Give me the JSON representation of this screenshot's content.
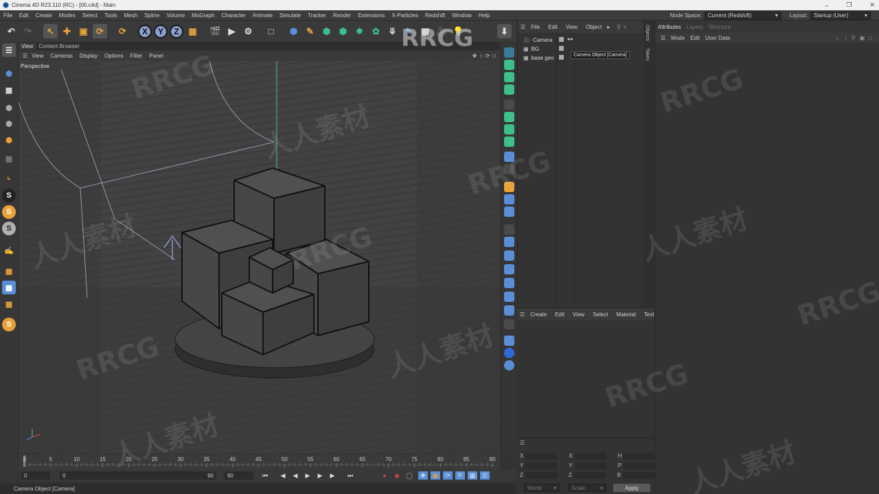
{
  "window": {
    "title": "Cinema 4D R23.110 (RC) - [00.c4d] - Main"
  },
  "menubar": {
    "items": [
      "File",
      "Edit",
      "Create",
      "Modes",
      "Select",
      "Tools",
      "Mesh",
      "Spline",
      "Volume",
      "MoGraph",
      "Character",
      "Animate",
      "Simulate",
      "Tracker",
      "Render",
      "Extensions",
      "X-Particles",
      "Redshift",
      "Window",
      "Help"
    ],
    "node_space_label": "Node Space:",
    "node_space_value": "Current (Redshift)",
    "layout_label": "Layout:",
    "layout_value": "Startup (User)"
  },
  "toolbar": {
    "axis_x": "X",
    "axis_y": "Y",
    "axis_z": "Z"
  },
  "viewport": {
    "tabs": [
      "View",
      "Content Browser"
    ],
    "menu": [
      "View",
      "Cameras",
      "Display",
      "Options",
      "Filter",
      "Panel"
    ],
    "label": "Perspective"
  },
  "timeline": {
    "ticks": [
      "0",
      "5",
      "10",
      "15",
      "20",
      "25",
      "30",
      "35",
      "40",
      "45",
      "50",
      "55",
      "60",
      "65",
      "70",
      "75",
      "80",
      "85",
      "90"
    ],
    "current_frame": "0",
    "start_field": "0",
    "min_field": "0",
    "max_field": "90",
    "end_field": "90"
  },
  "object_manager": {
    "menu": [
      "File",
      "Edit",
      "View",
      "Object"
    ],
    "objects": [
      "Camera",
      "BG",
      "base geo"
    ],
    "tooltip": "Camera Object [Camera]"
  },
  "side_tabs": [
    "Objects",
    "Takes"
  ],
  "material_manager": {
    "menu": [
      "Create",
      "Edit",
      "View",
      "Select",
      "Material",
      "Texture"
    ]
  },
  "coordinate_manager": {
    "left_labels": [
      "X",
      "Y",
      "Z"
    ],
    "mid_labels": [
      "X",
      "Y",
      "Z"
    ],
    "right_labels": [
      "H",
      "P",
      "B"
    ],
    "dropdown_left": "World",
    "dropdown_right": "Scale",
    "apply_label": "Apply"
  },
  "attribute_manager": {
    "tabs": [
      "Attributes",
      "Layers",
      "Structure"
    ],
    "menu": [
      "Mode",
      "Edit",
      "User Data"
    ]
  },
  "status_bar": {
    "text": "Camera Object [Camera]"
  },
  "watermarks": [
    "RRCG",
    "人人素材"
  ],
  "colors": {
    "accent_orange": "#e8a23a",
    "accent_green": "#3cbf8a",
    "accent_blue": "#5a8fd8",
    "apply_button": "#5a5a5a"
  }
}
